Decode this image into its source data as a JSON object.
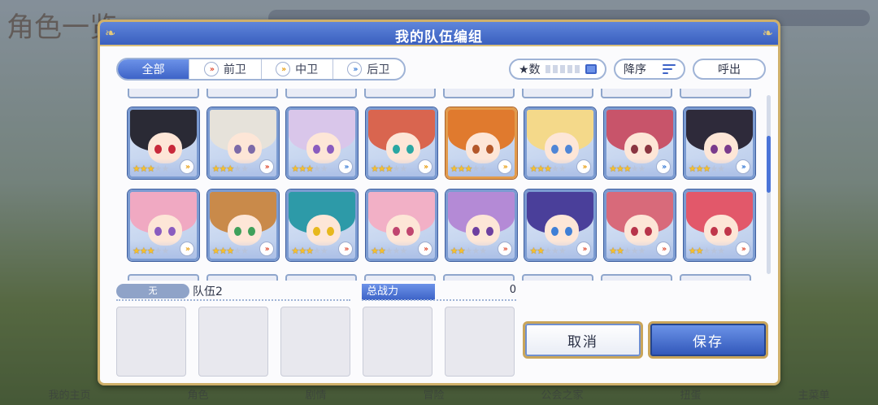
{
  "background": {
    "screen_title": "角色一览",
    "bottom_nav": [
      "我的主页",
      "角色",
      "剧情",
      "冒险",
      "公会之家",
      "扭蛋",
      "主菜单"
    ]
  },
  "dialog": {
    "title": "我的队伍编组"
  },
  "filter_tabs": [
    {
      "label": "全部",
      "active": true,
      "icon": null
    },
    {
      "label": "前卫",
      "active": false,
      "icon": "front-position-icon",
      "color": "#e0553d"
    },
    {
      "label": "中卫",
      "active": false,
      "icon": "middle-position-icon",
      "color": "#e9a21c"
    },
    {
      "label": "后卫",
      "active": false,
      "icon": "back-position-icon",
      "color": "#3f7fd6"
    }
  ],
  "sort": {
    "field_label": "★数",
    "order_label": "降序",
    "call_label": "呼出"
  },
  "characters_row1": [
    {
      "stars": 3,
      "hair": "#2a2a35",
      "eye": "#c8283a",
      "frame": "blue",
      "pos_color": "#e9a21c"
    },
    {
      "stars": 3,
      "hair": "#e6e2da",
      "eye": "#7d6aa8",
      "frame": "blue",
      "pos_color": "#e0553d"
    },
    {
      "stars": 3,
      "hair": "#d9c6ea",
      "eye": "#8a5cbf",
      "frame": "blue",
      "pos_color": "#3f7fd6"
    },
    {
      "stars": 3,
      "hair": "#d9654f",
      "eye": "#2aa7a2",
      "frame": "blue",
      "pos_color": "#e9a21c"
    },
    {
      "stars": 3,
      "hair": "#e07a2e",
      "eye": "#b4582a",
      "frame": "gold",
      "pos_color": "#e9a21c"
    },
    {
      "stars": 3,
      "hair": "#f4d98a",
      "eye": "#4f86d6",
      "frame": "blue",
      "pos_color": "#e9a21c"
    },
    {
      "stars": 3,
      "hair": "#c8546a",
      "eye": "#8a3540",
      "frame": "blue",
      "pos_color": "#3f7fd6"
    },
    {
      "stars": 3,
      "hair": "#2e2a3a",
      "eye": "#7a3a8c",
      "frame": "blue",
      "pos_color": "#3f7fd6"
    }
  ],
  "characters_row2": [
    {
      "stars": 3,
      "hair": "#f0a9c2",
      "eye": "#8a5cbf",
      "frame": "blue",
      "pos_color": "#e9a21c"
    },
    {
      "stars": 3,
      "hair": "#c98a4a",
      "eye": "#3fa05a",
      "frame": "blue",
      "pos_color": "#e0553d"
    },
    {
      "stars": 3,
      "hair": "#2d9aa8",
      "eye": "#e7b81c",
      "frame": "blue",
      "pos_color": "#e0553d"
    },
    {
      "stars": 2,
      "hair": "#f2b0c6",
      "eye": "#c0456f",
      "frame": "blue",
      "pos_color": "#e0553d"
    },
    {
      "stars": 2,
      "hair": "#b48ad6",
      "eye": "#6d3fa0",
      "frame": "blue",
      "pos_color": "#e0553d"
    },
    {
      "stars": 2,
      "hair": "#4a3f9a",
      "eye": "#3f7fd6",
      "frame": "blue",
      "pos_color": "#e0553d"
    },
    {
      "stars": 2,
      "hair": "#d86a7a",
      "eye": "#b8344a",
      "frame": "blue",
      "pos_color": "#e0553d"
    },
    {
      "stars": 2,
      "hair": "#e2586a",
      "eye": "#c0364a",
      "frame": "blue",
      "pos_color": "#e0553d"
    }
  ],
  "team": {
    "badge_label": "无",
    "name": "队伍2",
    "power_label": "总战力",
    "power_value": "0",
    "slot_count": 5
  },
  "buttons": {
    "cancel_label": "取消",
    "save_label": "保存"
  }
}
